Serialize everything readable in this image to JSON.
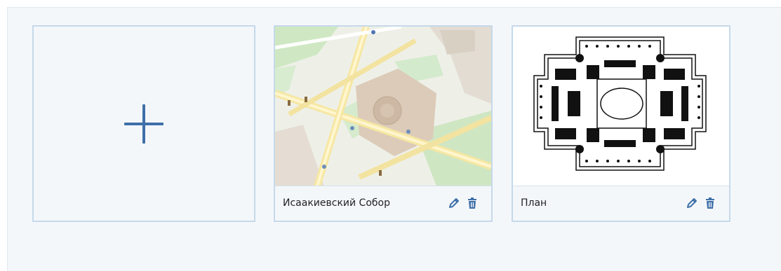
{
  "add_card": {
    "icon": "plus-icon"
  },
  "cards": [
    {
      "caption": "Исаакиевский Собор",
      "image": "map-thumbnail"
    },
    {
      "caption": "План",
      "image": "floor-plan-thumbnail"
    }
  ],
  "icons": {
    "edit": "pencil-icon",
    "delete": "trash-icon"
  },
  "colors": {
    "accent": "#3f70a8",
    "border": "#c5d9ea",
    "panel_bg": "#f4f7fa"
  }
}
